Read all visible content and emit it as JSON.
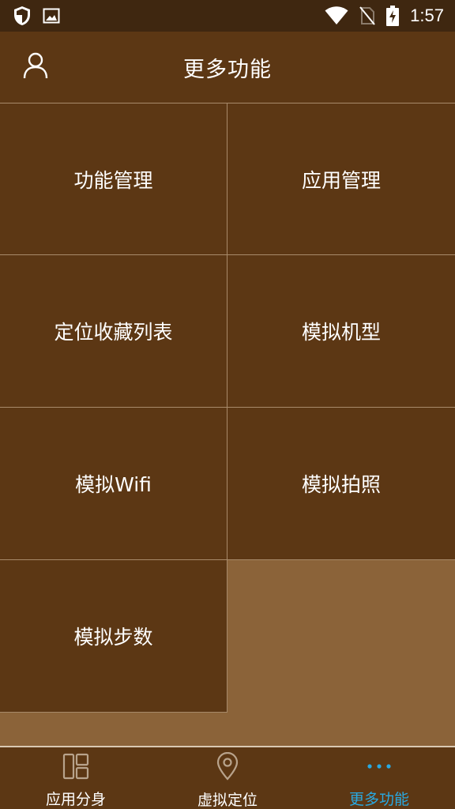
{
  "status_bar": {
    "time": "1:57",
    "icons_left": [
      "shield-icon",
      "image-icon"
    ],
    "icons_right": [
      "wifi-icon",
      "no-sim-icon",
      "battery-charging-icon"
    ]
  },
  "header": {
    "title": "更多功能",
    "user_icon": "user-icon"
  },
  "grid": {
    "items": [
      {
        "label": "功能管理"
      },
      {
        "label": "应用管理"
      },
      {
        "label": "定位收藏列表"
      },
      {
        "label": "模拟机型"
      },
      {
        "label": "模拟Wifi"
      },
      {
        "label": "模拟拍照"
      },
      {
        "label": "模拟步数"
      }
    ]
  },
  "bottom_nav": {
    "items": [
      {
        "label": "应用分身",
        "icon": "layout-icon"
      },
      {
        "label": "虚拟定位",
        "icon": "location-pin-icon"
      },
      {
        "label": "更多功能",
        "icon": "more-dots-icon",
        "active": true
      }
    ]
  },
  "colors": {
    "status_bar_bg": "#3f2710",
    "primary_bg": "#5c3714",
    "page_bg": "#8b6339",
    "divider": "#a88a6a",
    "active_accent": "#29a9e1",
    "text": "#ffffff"
  }
}
